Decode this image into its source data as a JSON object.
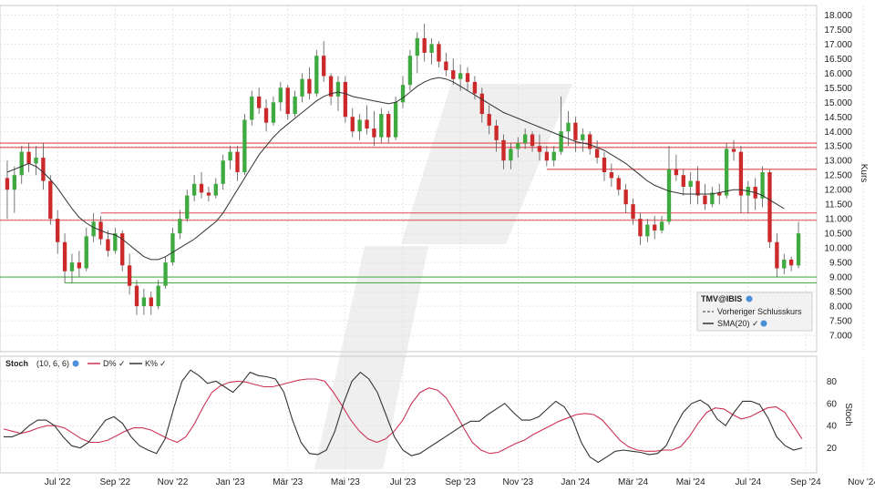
{
  "chart_data": [
    {
      "type": "candlestick",
      "symbol": "TMV@IBIS",
      "ylabel": "Kurs",
      "ylim": [
        6500,
        18200
      ],
      "y_ticks": [
        7000,
        7500,
        8000,
        8500,
        9000,
        9500,
        10000,
        10500,
        11000,
        11500,
        12000,
        12500,
        13000,
        13500,
        14000,
        14500,
        15000,
        15500,
        16000,
        16500,
        17000,
        17500,
        18000
      ],
      "y_tick_labels": [
        "7.000",
        "7.500",
        "8.000",
        "8.500",
        "9.000",
        "9.500",
        "10.000",
        "10.500",
        "11.000",
        "11.500",
        "12.000",
        "12.500",
        "13.000",
        "13.500",
        "14.000",
        "14.500",
        "15.000",
        "15.500",
        "16.000",
        "16.500",
        "17.000",
        "17.500",
        "18.000"
      ],
      "x_tick_labels": [
        "Jul '22",
        "Sep '22",
        "Nov '22",
        "Jan '23",
        "Mär '23",
        "Mai '23",
        "Jul '23",
        "Sep '23",
        "Nov '23",
        "Jan '24",
        "Mär '24",
        "Mai '24",
        "Jul '24",
        "Sep '24",
        "Nov '24"
      ],
      "x_tick_index": [
        7,
        15,
        23,
        31,
        39,
        47,
        55,
        63,
        71,
        79,
        87,
        95,
        103,
        111,
        119
      ],
      "candles": [
        [
          12400,
          13000,
          11000,
          12000
        ],
        [
          12000,
          12800,
          11200,
          12500
        ],
        [
          12500,
          13500,
          12200,
          13300
        ],
        [
          13300,
          13600,
          12600,
          12900
        ],
        [
          12900,
          13500,
          12500,
          13100
        ],
        [
          13100,
          13600,
          12000,
          12300
        ],
        [
          12300,
          12500,
          10800,
          11000
        ],
        [
          11000,
          11300,
          9800,
          10200
        ],
        [
          10200,
          10500,
          8800,
          9200
        ],
        [
          9200,
          9800,
          8800,
          9500
        ],
        [
          9500,
          9900,
          9000,
          9300
        ],
        [
          9300,
          10700,
          9200,
          10400
        ],
        [
          10400,
          11200,
          10200,
          10900
        ],
        [
          10900,
          11100,
          10100,
          10300
        ],
        [
          10300,
          10600,
          9700,
          9900
        ],
        [
          9900,
          10700,
          9800,
          10500
        ],
        [
          10500,
          10600,
          9200,
          9400
        ],
        [
          9400,
          9800,
          8400,
          8700
        ],
        [
          8700,
          8900,
          7700,
          8000
        ],
        [
          8000,
          8600,
          7700,
          8300
        ],
        [
          8300,
          8500,
          7700,
          8000
        ],
        [
          8000,
          8900,
          7900,
          8700
        ],
        [
          8700,
          9700,
          8600,
          9500
        ],
        [
          9500,
          10700,
          9400,
          10500
        ],
        [
          10500,
          11300,
          10300,
          11000
        ],
        [
          11000,
          12000,
          10900,
          11800
        ],
        [
          11800,
          12500,
          11600,
          12200
        ],
        [
          12200,
          12600,
          11700,
          11900
        ],
        [
          11900,
          12100,
          11600,
          11800
        ],
        [
          11800,
          12400,
          11700,
          12200
        ],
        [
          12200,
          13200,
          12000,
          13000
        ],
        [
          13000,
          13500,
          12700,
          13300
        ],
        [
          13300,
          13500,
          12300,
          12600
        ],
        [
          12600,
          14600,
          12500,
          14400
        ],
        [
          14400,
          15400,
          14200,
          15200
        ],
        [
          15200,
          15500,
          14600,
          14800
        ],
        [
          14800,
          15100,
          14000,
          14300
        ],
        [
          14300,
          15200,
          14200,
          15000
        ],
        [
          15000,
          15700,
          14700,
          15500
        ],
        [
          15500,
          15600,
          14400,
          14600
        ],
        [
          14600,
          15400,
          14500,
          15200
        ],
        [
          15200,
          16000,
          15000,
          15800
        ],
        [
          15800,
          16200,
          15100,
          15300
        ],
        [
          15300,
          16800,
          15200,
          16600
        ],
        [
          16600,
          17100,
          15700,
          15900
        ],
        [
          15900,
          16000,
          14900,
          15200
        ],
        [
          15200,
          15900,
          14700,
          15700
        ],
        [
          15700,
          15900,
          14300,
          14500
        ],
        [
          14500,
          14800,
          13800,
          14000
        ],
        [
          14000,
          14600,
          13700,
          14400
        ],
        [
          14400,
          14900,
          13900,
          14100
        ],
        [
          14100,
          14700,
          13500,
          13800
        ],
        [
          13800,
          14800,
          13600,
          14600
        ],
        [
          14600,
          14700,
          13600,
          13800
        ],
        [
          13800,
          15200,
          13700,
          15000
        ],
        [
          15000,
          15900,
          14800,
          15600
        ],
        [
          15600,
          16800,
          15400,
          16600
        ],
        [
          16600,
          17400,
          16000,
          17200
        ],
        [
          17200,
          17700,
          16400,
          16700
        ],
        [
          16700,
          17200,
          16300,
          17000
        ],
        [
          17000,
          17100,
          16200,
          16400
        ],
        [
          16400,
          16700,
          15900,
          16100
        ],
        [
          16100,
          16500,
          15600,
          15800
        ],
        [
          15800,
          16300,
          15400,
          16000
        ],
        [
          16000,
          16200,
          15400,
          15700
        ],
        [
          15700,
          15900,
          15100,
          15300
        ],
        [
          15300,
          15500,
          14300,
          14600
        ],
        [
          14600,
          14900,
          13900,
          14200
        ],
        [
          14200,
          14400,
          13300,
          13700
        ],
        [
          13700,
          13900,
          12700,
          13000
        ],
        [
          13000,
          13600,
          12700,
          13400
        ],
        [
          13400,
          13800,
          13100,
          13600
        ],
        [
          13600,
          14100,
          13400,
          13900
        ],
        [
          13900,
          14000,
          13300,
          13500
        ],
        [
          13500,
          13900,
          13000,
          13300
        ],
        [
          13300,
          13500,
          12800,
          13000
        ],
        [
          13000,
          13500,
          12800,
          13300
        ],
        [
          13300,
          15200,
          13200,
          14000
        ],
        [
          14000,
          14700,
          13500,
          14300
        ],
        [
          14300,
          14500,
          13300,
          13700
        ],
        [
          13700,
          14100,
          13300,
          13900
        ],
        [
          13900,
          14000,
          13200,
          13400
        ],
        [
          13400,
          13700,
          12900,
          13100
        ],
        [
          13100,
          13300,
          12300,
          12600
        ],
        [
          12600,
          12900,
          12100,
          12400
        ],
        [
          12400,
          12500,
          11800,
          12000
        ],
        [
          12000,
          12200,
          11200,
          11500
        ],
        [
          11500,
          11700,
          10800,
          11000
        ],
        [
          11000,
          11200,
          10100,
          10400
        ],
        [
          10400,
          11000,
          10200,
          10800
        ],
        [
          10800,
          11100,
          10300,
          10600
        ],
        [
          10600,
          11100,
          10500,
          10900
        ],
        [
          10900,
          13500,
          10800,
          12700
        ],
        [
          12700,
          13200,
          12300,
          12500
        ],
        [
          12500,
          12700,
          11800,
          12100
        ],
        [
          12100,
          12600,
          11500,
          12300
        ],
        [
          12300,
          12800,
          11500,
          11800
        ],
        [
          11800,
          12200,
          11300,
          11500
        ],
        [
          11500,
          12100,
          11400,
          11900
        ],
        [
          11900,
          12200,
          11500,
          11800
        ],
        [
          11800,
          13600,
          11700,
          13400
        ],
        [
          13400,
          13700,
          13000,
          13300
        ],
        [
          13300,
          13500,
          11200,
          11800
        ],
        [
          11800,
          12300,
          11200,
          12100
        ],
        [
          12100,
          12400,
          11300,
          11700
        ],
        [
          11700,
          12800,
          11400,
          12600
        ],
        [
          12600,
          12700,
          10000,
          10200
        ],
        [
          10200,
          10500,
          9000,
          9300
        ],
        [
          9300,
          9800,
          9100,
          9600
        ],
        [
          9600,
          9700,
          9200,
          9400
        ],
        [
          9400,
          10900,
          9300,
          10500
        ]
      ],
      "sma_label": "SMA(20)",
      "sma": [
        12600,
        12700,
        12800,
        12900,
        12800,
        12600,
        12350,
        12050,
        11700,
        11350,
        11050,
        10850,
        10700,
        10600,
        10500,
        10450,
        10300,
        10100,
        9900,
        9700,
        9600,
        9600,
        9700,
        9850,
        10000,
        10150,
        10300,
        10500,
        10700,
        10900,
        11200,
        11600,
        12000,
        12400,
        12800,
        13200,
        13500,
        13800,
        14050,
        14250,
        14450,
        14650,
        14850,
        15050,
        15200,
        15300,
        15350,
        15300,
        15200,
        15150,
        15100,
        15050,
        15000,
        14950,
        15000,
        15150,
        15350,
        15550,
        15700,
        15800,
        15850,
        15800,
        15700,
        15550,
        15400,
        15250,
        15100,
        14950,
        14800,
        14650,
        14550,
        14450,
        14350,
        14250,
        14150,
        14050,
        13950,
        13850,
        13750,
        13650,
        13600,
        13550,
        13450,
        13350,
        13200,
        13050,
        12900,
        12700,
        12500,
        12300,
        12150,
        12050,
        11950,
        11900,
        11850,
        11850,
        11850,
        11850,
        11850,
        11900,
        11950,
        12000,
        12000,
        11950,
        11900,
        11800,
        11650,
        11500,
        11350
      ],
      "support_lines": [
        {
          "y": 13600,
          "color": "#e04a4a"
        },
        {
          "y": 13450,
          "color": "#e04a4a"
        },
        {
          "y": 12700,
          "color": "#e04a4a",
          "from_index": 75
        },
        {
          "y": 11200,
          "color": "#e04a4a",
          "from_index": 13
        },
        {
          "y": 10950,
          "color": "#e04a4a"
        },
        {
          "y": 9000,
          "color": "#4cae4c"
        },
        {
          "y": 8800,
          "color": "#4cae4c",
          "from_index": 8
        }
      ],
      "legend": {
        "title": "TMV@IBIS",
        "entries": [
          "Vorheriger Schlusskurs",
          "SMA(20)"
        ],
        "placement": "bottom-right"
      },
      "colors": {
        "up": "#3faa3f",
        "down": "#cc2a2a",
        "sma": "#333333",
        "grid": "#d9d9d9"
      }
    },
    {
      "type": "line",
      "title": "Stoch",
      "params": "(10, 6, 6)",
      "ylim": [
        0,
        100
      ],
      "y_ticks": [
        20,
        40,
        60,
        80
      ],
      "y_tick_labels": [
        "20",
        "40",
        "60",
        "80"
      ],
      "ylabel": "Stoch",
      "series": [
        {
          "name": "D%",
          "color": "#cc3355",
          "values": [
            37,
            35,
            33,
            35,
            38,
            40,
            40,
            38,
            33,
            28,
            25,
            25,
            27,
            31,
            35,
            38,
            38,
            36,
            32,
            28,
            25,
            30,
            42,
            57,
            70,
            76,
            79,
            80,
            79,
            77,
            75,
            75,
            77,
            79,
            81,
            82,
            82,
            80,
            70,
            58,
            45,
            35,
            28,
            25,
            28,
            35,
            45,
            60,
            70,
            74,
            72,
            65,
            52,
            38,
            25,
            18,
            15,
            16,
            20,
            24,
            27,
            32,
            36,
            40,
            44,
            47,
            50,
            51,
            50,
            45,
            36,
            27,
            21,
            18,
            17,
            17,
            18,
            18,
            21,
            30,
            42,
            52,
            56,
            55,
            50,
            46,
            48,
            52,
            56,
            57,
            52,
            40,
            28
          ]
        },
        {
          "name": "K%",
          "color": "#333333",
          "values": [
            30,
            30,
            33,
            40,
            45,
            45,
            40,
            30,
            22,
            20,
            25,
            35,
            45,
            48,
            42,
            30,
            22,
            18,
            15,
            28,
            55,
            80,
            90,
            85,
            78,
            80,
            75,
            70,
            78,
            88,
            85,
            84,
            82,
            70,
            45,
            25,
            15,
            14,
            18,
            35,
            60,
            80,
            88,
            82,
            70,
            50,
            30,
            18,
            13,
            15,
            20,
            25,
            30,
            35,
            40,
            44,
            44,
            50,
            55,
            60,
            52,
            45,
            45,
            48,
            55,
            62,
            57,
            45,
            25,
            12,
            7,
            12,
            17,
            18,
            17,
            16,
            14,
            15,
            22,
            38,
            52,
            60,
            63,
            58,
            46,
            40,
            52,
            62,
            62,
            59,
            47,
            30,
            22,
            18,
            20
          ]
        }
      ]
    }
  ]
}
